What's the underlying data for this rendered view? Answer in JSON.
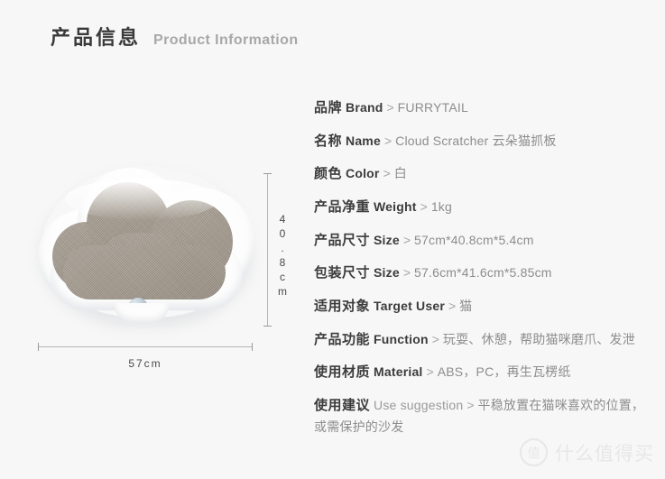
{
  "header": {
    "title_cn": "产品信息",
    "title_en": "Product Information"
  },
  "figure": {
    "alt_name": "cloud-cat-scratcher",
    "height_label": "40.8cm",
    "width_label": "57cm"
  },
  "specs": [
    {
      "label_cn": "品牌",
      "label_en": "Brand",
      "separator": ">",
      "value": "FURRYTAIL",
      "soft_en": false
    },
    {
      "label_cn": "名称",
      "label_en": "Name",
      "separator": ">",
      "value": "Cloud Scratcher 云朵猫抓板",
      "soft_en": false
    },
    {
      "label_cn": "颜色",
      "label_en": "Color",
      "separator": ">",
      "value": "白",
      "soft_en": false
    },
    {
      "label_cn": "产品净重",
      "label_en": "Weight",
      "separator": ">",
      "value": "1kg",
      "soft_en": false
    },
    {
      "label_cn": "产品尺寸",
      "label_en": "Size",
      "separator": ">",
      "value": "57cm*40.8cm*5.4cm",
      "soft_en": false
    },
    {
      "label_cn": "包装尺寸",
      "label_en": "Size",
      "separator": ">",
      "value": "57.6cm*41.6cm*5.85cm",
      "soft_en": false
    },
    {
      "label_cn": "适用对象",
      "label_en": "Target User",
      "separator": ">",
      "value": "猫",
      "soft_en": false
    },
    {
      "label_cn": "产品功能",
      "label_en": "Function",
      "separator": ">",
      "value": "玩耍、休憩，帮助猫咪磨爪、发泄",
      "soft_en": false
    },
    {
      "label_cn": "使用材质",
      "label_en": "Material",
      "separator": ">",
      "value": "ABS，PC，再生瓦楞纸",
      "soft_en": false
    },
    {
      "label_cn": "使用建议",
      "label_en": "Use suggestion",
      "separator": ">",
      "value": "平稳放置在猫咪喜欢的位置，或需保护的沙发",
      "soft_en": true
    }
  ],
  "watermark": {
    "badge": "值",
    "text": "什么值得买"
  },
  "colors": {
    "background": "#f7f7f7",
    "label_dark": "#3c3c3c",
    "value_gray": "#8d8d8d",
    "header_en_gray": "#a8a8a8",
    "product_texture": "#a39a8e",
    "product_frame": "#fdfdfd"
  }
}
